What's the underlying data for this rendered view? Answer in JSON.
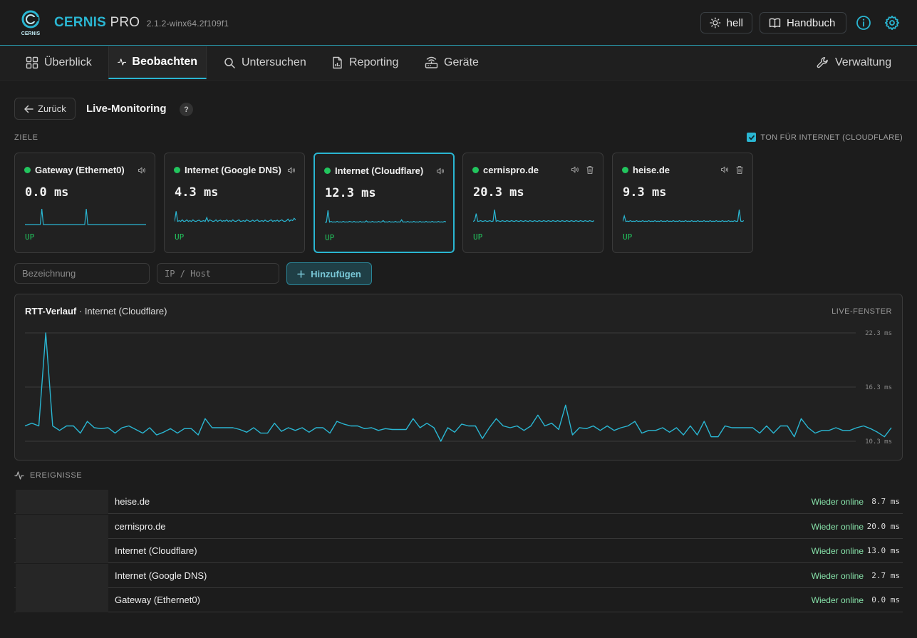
{
  "app": {
    "brand_primary": "CERNIS",
    "brand_secondary": "PRO",
    "logo_text": "CERNIS",
    "version": "2.1.2-winx64.2f109f1",
    "accent_color": "#2ab6d2",
    "status_up_color": "#22c55e"
  },
  "header": {
    "theme_label": "hell",
    "manual_label": "Handbuch",
    "info_icon": "info-icon",
    "settings_icon": "gear-icon"
  },
  "nav": {
    "items": [
      {
        "label": "Überblick",
        "icon": "grid-icon"
      },
      {
        "label": "Beobachten",
        "icon": "activity-icon",
        "active": true
      },
      {
        "label": "Untersuchen",
        "icon": "search-icon"
      },
      {
        "label": "Reporting",
        "icon": "document-chart-icon"
      },
      {
        "label": "Geräte",
        "icon": "router-icon"
      }
    ],
    "admin_label": "Verwaltung"
  },
  "page": {
    "back_label": "Zurück",
    "title": "Live-Monitoring",
    "help_label": "?",
    "targets_label": "ZIELE",
    "sound_label": "TON FÜR INTERNET (CLOUDFLARE)",
    "sound_checked": true
  },
  "targets": [
    {
      "name": "Gateway (Ethernet0)",
      "value": "0.0 ms",
      "status": "UP",
      "deletable": false,
      "selected": false,
      "spark": [
        0,
        0,
        0,
        0,
        0,
        0,
        0,
        0,
        0,
        0,
        0,
        1,
        0,
        0,
        0,
        0,
        0,
        0,
        0,
        0,
        0,
        0,
        0,
        0,
        0,
        0,
        0,
        0,
        0,
        0,
        0,
        0,
        0,
        0,
        0,
        0,
        0,
        0,
        0,
        0,
        1,
        0,
        0,
        0,
        0,
        0,
        0,
        0,
        0,
        0,
        0,
        0,
        0,
        0,
        0,
        0,
        0,
        0,
        0,
        0,
        0,
        0,
        0,
        0,
        0,
        0,
        0,
        0,
        0,
        0,
        0,
        0,
        0,
        0,
        0,
        0,
        0,
        0,
        0,
        0
      ]
    },
    {
      "name": "Internet (Google DNS)",
      "value": "4.3 ms",
      "status": "UP",
      "deletable": false,
      "selected": false,
      "spark": [
        0.2,
        0.85,
        0.2,
        0.25,
        0.2,
        0.3,
        0.2,
        0.22,
        0.3,
        0.2,
        0.25,
        0.2,
        0.3,
        0.22,
        0.2,
        0.25,
        0.28,
        0.2,
        0.22,
        0.25,
        0.2,
        0.45,
        0.2,
        0.3,
        0.25,
        0.2,
        0.22,
        0.3,
        0.2,
        0.25,
        0.28,
        0.2,
        0.25,
        0.22,
        0.3,
        0.2,
        0.25,
        0.2,
        0.3,
        0.22,
        0.2,
        0.25,
        0.3,
        0.2,
        0.22,
        0.25,
        0.2,
        0.3,
        0.25,
        0.2,
        0.22,
        0.28,
        0.2,
        0.25,
        0.3,
        0.2,
        0.22,
        0.25,
        0.2,
        0.28,
        0.22,
        0.2,
        0.25,
        0.3,
        0.2,
        0.25,
        0.22,
        0.28,
        0.2,
        0.25,
        0.3,
        0.22,
        0.2,
        0.25,
        0.35,
        0.22,
        0.3,
        0.25,
        0.4,
        0.3
      ]
    },
    {
      "name": "Internet (Cloudflare)",
      "value": "12.3 ms",
      "status": "UP",
      "deletable": false,
      "selected": true,
      "spark": [
        0.2,
        0.2,
        0.95,
        0.2,
        0.25,
        0.2,
        0.22,
        0.2,
        0.25,
        0.2,
        0.22,
        0.2,
        0.25,
        0.2,
        0.22,
        0.2,
        0.25,
        0.22,
        0.2,
        0.25,
        0.2,
        0.22,
        0.2,
        0.25,
        0.2,
        0.22,
        0.2,
        0.28,
        0.2,
        0.22,
        0.2,
        0.25,
        0.2,
        0.22,
        0.2,
        0.25,
        0.2,
        0.22,
        0.3,
        0.2,
        0.22,
        0.2,
        0.25,
        0.2,
        0.22,
        0.2,
        0.25,
        0.2,
        0.22,
        0.2,
        0.35,
        0.2,
        0.22,
        0.2,
        0.25,
        0.2,
        0.22,
        0.2,
        0.25,
        0.2,
        0.22,
        0.2,
        0.25,
        0.2,
        0.22,
        0.2,
        0.25,
        0.2,
        0.22,
        0.2,
        0.25,
        0.2,
        0.22,
        0.2,
        0.25,
        0.2,
        0.22,
        0.2,
        0.25,
        0.22
      ]
    },
    {
      "name": "cernispro.de",
      "value": "20.3 ms",
      "status": "UP",
      "deletable": true,
      "selected": false,
      "spark": [
        0.2,
        0.25,
        0.7,
        0.2,
        0.22,
        0.25,
        0.2,
        0.22,
        0.25,
        0.2,
        0.22,
        0.25,
        0.2,
        0.22,
        0.95,
        0.2,
        0.25,
        0.22,
        0.2,
        0.25,
        0.22,
        0.2,
        0.25,
        0.22,
        0.2,
        0.25,
        0.22,
        0.2,
        0.25,
        0.22,
        0.2,
        0.25,
        0.22,
        0.2,
        0.25,
        0.22,
        0.2,
        0.25,
        0.22,
        0.2,
        0.25,
        0.22,
        0.2,
        0.25,
        0.22,
        0.2,
        0.25,
        0.22,
        0.2,
        0.25,
        0.22,
        0.2,
        0.25,
        0.22,
        0.2,
        0.25,
        0.22,
        0.2,
        0.25,
        0.22,
        0.2,
        0.25,
        0.22,
        0.2,
        0.25,
        0.22,
        0.2,
        0.25,
        0.22,
        0.2,
        0.25,
        0.22,
        0.2,
        0.25,
        0.22,
        0.2,
        0.25,
        0.22,
        0.2,
        0.25
      ]
    },
    {
      "name": "heise.de",
      "value": "9.3 ms",
      "status": "UP",
      "deletable": true,
      "selected": false,
      "spark": [
        0.2,
        0.55,
        0.2,
        0.22,
        0.2,
        0.25,
        0.2,
        0.22,
        0.2,
        0.25,
        0.2,
        0.22,
        0.2,
        0.25,
        0.2,
        0.22,
        0.2,
        0.25,
        0.2,
        0.22,
        0.2,
        0.25,
        0.2,
        0.22,
        0.2,
        0.25,
        0.2,
        0.22,
        0.2,
        0.25,
        0.2,
        0.22,
        0.2,
        0.25,
        0.2,
        0.22,
        0.2,
        0.25,
        0.2,
        0.22,
        0.2,
        0.25,
        0.2,
        0.22,
        0.2,
        0.25,
        0.2,
        0.22,
        0.2,
        0.25,
        0.2,
        0.22,
        0.2,
        0.25,
        0.2,
        0.22,
        0.2,
        0.25,
        0.2,
        0.22,
        0.2,
        0.25,
        0.2,
        0.22,
        0.2,
        0.25,
        0.2,
        0.22,
        0.2,
        0.25,
        0.2,
        0.22,
        0.2,
        0.25,
        0.2,
        0.22,
        0.95,
        0.22,
        0.2,
        0.25
      ]
    }
  ],
  "add_form": {
    "name_placeholder": "Bezeichnung",
    "host_placeholder": "IP / Host",
    "add_label": "Hinzufügen"
  },
  "chart": {
    "title": "RTT-Verlauf",
    "subtitle": "Internet (Cloudflare)",
    "window_label": "LIVE-FENSTER",
    "ticks": [
      "22.3 ms",
      "16.3 ms",
      "10.3 ms"
    ]
  },
  "chart_data": {
    "type": "line",
    "title": "RTT-Verlauf · Internet (Cloudflare)",
    "ylabel": "ms",
    "ylim": [
      10.3,
      22.3
    ],
    "series": [
      {
        "values": [
          12.0,
          12.3,
          12.0,
          22.3,
          12.0,
          11.5,
          12.0,
          12.0,
          11.2,
          12.5,
          11.8,
          11.7,
          11.8,
          11.2,
          11.8,
          12.0,
          11.6,
          11.2,
          11.8,
          11.0,
          11.3,
          11.7,
          11.2,
          11.7,
          11.7,
          11.0,
          12.8,
          11.8,
          11.8,
          11.8,
          11.8,
          11.6,
          11.3,
          11.8,
          11.2,
          11.2,
          12.3,
          11.4,
          11.8,
          11.5,
          11.8,
          11.3,
          11.8,
          11.8,
          11.2,
          12.5,
          12.2,
          12.0,
          12.0,
          11.7,
          11.8,
          11.5,
          11.7,
          11.6,
          11.6,
          11.6,
          12.8,
          11.8,
          12.3,
          11.8,
          10.3,
          11.8,
          11.3,
          12.2,
          12.0,
          12.0,
          10.6,
          11.8,
          12.8,
          12.0,
          11.8,
          12.0,
          11.5,
          12.0,
          13.2,
          12.0,
          12.3,
          11.6,
          14.3,
          11.0,
          11.8,
          11.7,
          12.0,
          11.5,
          12.0,
          11.5,
          11.8,
          12.0,
          12.5,
          11.2,
          11.5,
          11.5,
          11.8,
          11.3,
          11.8,
          11.0,
          12.0,
          11.0,
          12.5,
          10.8,
          10.8,
          12.0,
          11.8,
          11.8,
          11.8,
          11.8,
          11.2,
          12.0,
          11.2,
          12.0,
          12.0,
          10.8,
          12.8,
          11.8,
          11.2,
          11.5,
          11.5,
          11.8,
          11.5,
          11.5,
          11.8,
          12.0,
          11.7,
          11.3,
          10.8,
          11.8
        ]
      }
    ],
    "grid": true
  },
  "events": {
    "label": "EREIGNISSE",
    "items": [
      {
        "name": "heise.de",
        "status": "Wieder online",
        "ms": "8.7 ms"
      },
      {
        "name": "cernispro.de",
        "status": "Wieder online",
        "ms": "20.0 ms"
      },
      {
        "name": "Internet (Cloudflare)",
        "status": "Wieder online",
        "ms": "13.0 ms"
      },
      {
        "name": "Internet (Google DNS)",
        "status": "Wieder online",
        "ms": "2.7 ms"
      },
      {
        "name": "Gateway (Ethernet0)",
        "status": "Wieder online",
        "ms": "0.0 ms"
      }
    ]
  }
}
